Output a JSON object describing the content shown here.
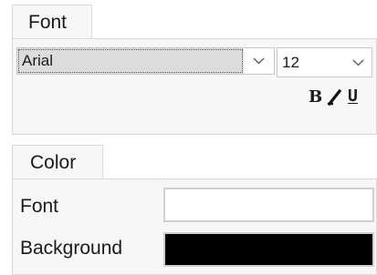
{
  "font_section": {
    "tab_label": "Font",
    "font_family": {
      "value": "Arial",
      "icon": "chevron-down-icon"
    },
    "font_size": {
      "value": "12",
      "icon": "chevron-down-icon"
    },
    "style_buttons": {
      "bold": "B",
      "italic_icon": "italic-slash-icon",
      "underline": "U"
    }
  },
  "color_section": {
    "tab_label": "Color",
    "rows": [
      {
        "label": "Font",
        "color": "#ffffff"
      },
      {
        "label": "Background",
        "color": "#000000"
      }
    ]
  }
}
